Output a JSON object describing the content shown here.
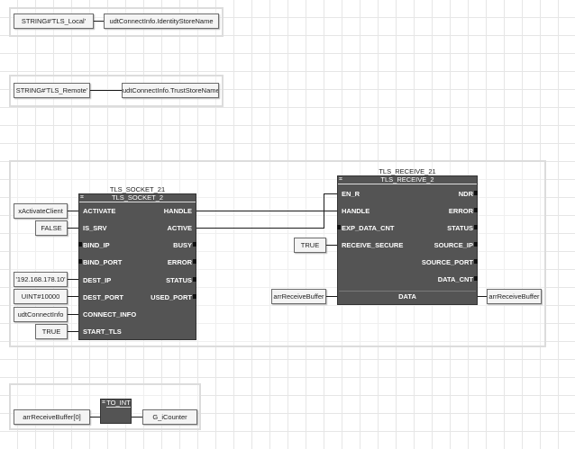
{
  "networks": {
    "n1": {
      "source": "STRING#'TLS_Local'",
      "target": "udtConnectInfo.IdentityStoreName"
    },
    "n2": {
      "source": "STRING#'TLS_Remote'",
      "target": "udtConnectInfo.TrustStoreName"
    },
    "n4": {
      "input": "arrReceiveBuffer[0]",
      "output": "G_iCounter"
    }
  },
  "socket": {
    "instance": "TLS_SOCKET_21",
    "type": "TLS_SOCKET_2",
    "inputs": [
      "ACTIVATE",
      "IS_SRV",
      "BIND_IP",
      "BIND_PORT",
      "DEST_IP",
      "DEST_PORT",
      "CONNECT_INFO",
      "START_TLS"
    ],
    "outputs": [
      "HANDLE",
      "ACTIVE",
      "BUSY",
      "ERROR",
      "STATUS",
      "USED_PORT"
    ],
    "args": [
      "xActivateClient",
      "FALSE",
      "'192.168.178.10'",
      "UINT#10000",
      "udtConnectInfo",
      "TRUE"
    ]
  },
  "receive": {
    "instance": "TLS_RECEIVE_21",
    "type": "TLS_RECEIVE_2",
    "inputs": [
      "EN_R",
      "HANDLE",
      "EXP_DATA_CNT",
      "RECEIVE_SECURE"
    ],
    "outputs": [
      "NDR",
      "ERROR",
      "STATUS",
      "SOURCE_IP",
      "SOURCE_PORT",
      "DATA_CNT"
    ],
    "inout": "DATA",
    "args": [
      "TRUE",
      "arrReceiveBuffer",
      "arrReceiveBuffer"
    ]
  },
  "toint": {
    "type": "TO_INT"
  },
  "icons": {
    "fb_marker": "function-block-icon",
    "toint_marker": "function-block-icon"
  },
  "colors": {
    "block_fill": "#545454",
    "wire": "#1a1a1a",
    "variable_fill": "#f4f4f4",
    "grid": "#e6e6e6"
  }
}
